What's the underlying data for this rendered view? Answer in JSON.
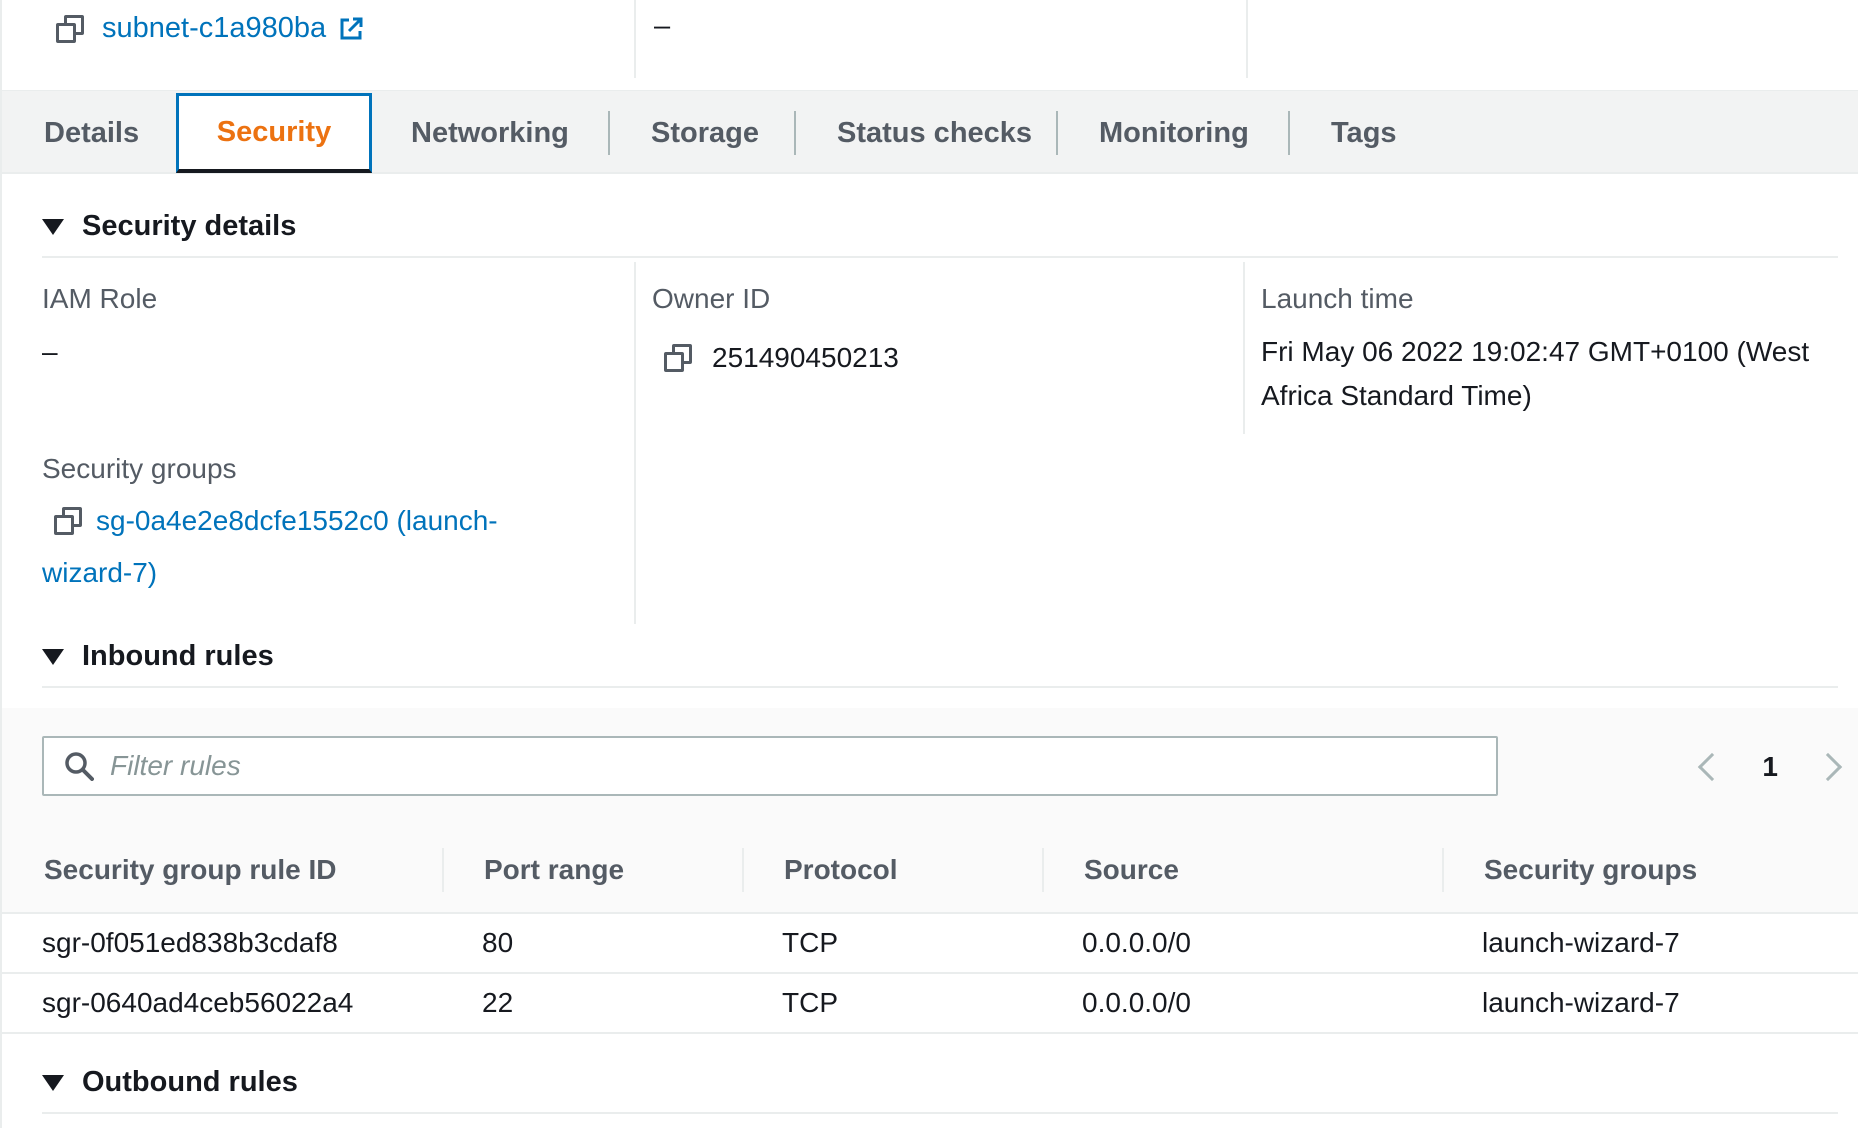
{
  "top": {
    "subnet_link": "subnet-c1a980ba",
    "col2_value": "–"
  },
  "tabs": [
    {
      "label": "Details"
    },
    {
      "label": "Security"
    },
    {
      "label": "Networking"
    },
    {
      "label": "Storage"
    },
    {
      "label": "Status checks"
    },
    {
      "label": "Monitoring"
    },
    {
      "label": "Tags"
    }
  ],
  "active_tab": "Security",
  "security_details": {
    "heading": "Security details",
    "iam_role_label": "IAM Role",
    "iam_role_value": "–",
    "owner_id_label": "Owner ID",
    "owner_id_value": "251490450213",
    "launch_time_label": "Launch time",
    "launch_time_line1": "Fri May 06 2022 19:02:47 GMT+0100 (West",
    "launch_time_line2": "Africa Standard Time)",
    "security_groups_label": "Security groups",
    "security_group_line1": "sg-0a4e2e8dcfe1552c0 (launch-",
    "security_group_line2": "wizard-7)"
  },
  "inbound": {
    "heading": "Inbound rules",
    "filter_placeholder": "Filter rules",
    "page_number": "1",
    "columns": [
      "Security group rule ID",
      "Port range",
      "Protocol",
      "Source",
      "Security groups"
    ],
    "rows": [
      [
        "sgr-0f051ed838b3cdaf8",
        "80",
        "TCP",
        "0.0.0.0/0",
        "launch-wizard-7"
      ],
      [
        "sgr-0640ad4ceb56022a4",
        "22",
        "TCP",
        "0.0.0.0/0",
        "launch-wizard-7"
      ]
    ]
  },
  "outbound": {
    "heading": "Outbound rules"
  },
  "colors": {
    "link": "#0073bb",
    "active_tab_text": "#ec7211",
    "active_tab_border": "#0073bb"
  },
  "icons": [
    "copy-icon",
    "external-link-icon",
    "caret-down-icon",
    "search-icon",
    "chevron-left-icon",
    "chevron-right-icon"
  ]
}
